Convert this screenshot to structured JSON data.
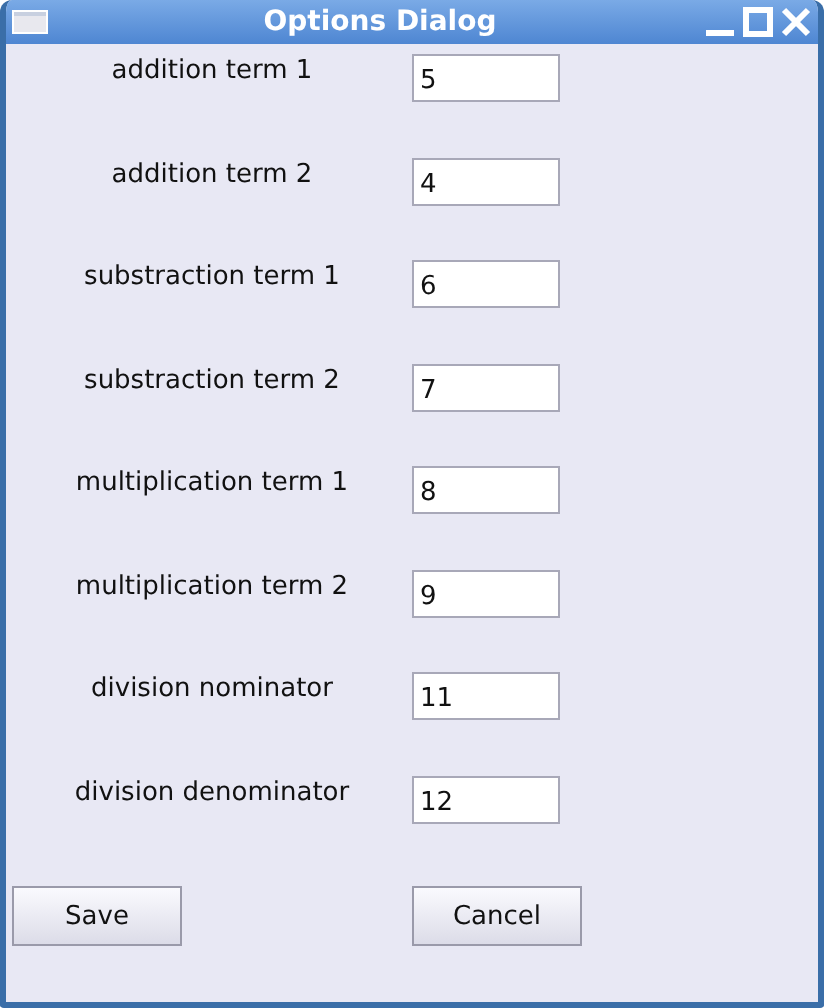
{
  "window": {
    "title": "Options Dialog"
  },
  "fields": [
    {
      "label": "addition term 1",
      "value": "5"
    },
    {
      "label": "addition term 2",
      "value": "4"
    },
    {
      "label": "substraction term 1",
      "value": "6"
    },
    {
      "label": "substraction term 2",
      "value": "7"
    },
    {
      "label": "multiplication term 1",
      "value": "8"
    },
    {
      "label": "multiplication term 2",
      "value": "9"
    },
    {
      "label": "division nominator",
      "value": "11"
    },
    {
      "label": "division denominator",
      "value": "12"
    }
  ],
  "buttons": [
    "Save",
    "Cancel"
  ]
}
